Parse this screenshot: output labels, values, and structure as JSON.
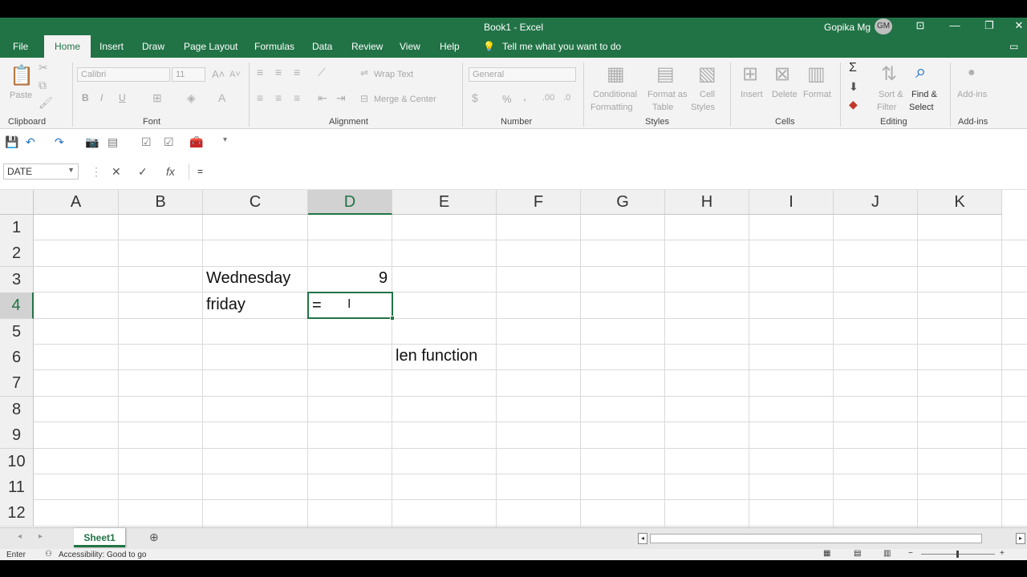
{
  "titlebar": {
    "title": "Book1  -  Excel",
    "user": "Gopika Mg",
    "initials": "GM"
  },
  "menu": {
    "file": "File",
    "home": "Home",
    "insert": "Insert",
    "draw": "Draw",
    "page_layout": "Page Layout",
    "formulas": "Formulas",
    "data": "Data",
    "review": "Review",
    "view": "View",
    "help": "Help",
    "tell_me": "Tell me what you want to do"
  },
  "ribbon": {
    "clipboard": {
      "label": "Clipboard",
      "paste": "Paste"
    },
    "font": {
      "label": "Font",
      "font_name": "Calibri",
      "font_size": "11",
      "bold": "B",
      "italic": "I",
      "underline": "U"
    },
    "alignment": {
      "label": "Alignment",
      "wrap_text": "Wrap Text",
      "merge_center": "Merge & Center"
    },
    "number": {
      "label": "Number",
      "format": "General",
      "percent": "%",
      "comma": ","
    },
    "styles": {
      "label": "Styles",
      "conditional": "Conditional",
      "formatting": "Formatting",
      "format_as": "Format as",
      "table": "Table",
      "cell": "Cell",
      "cell_styles": "Styles"
    },
    "cells": {
      "label": "Cells",
      "insert": "Insert",
      "delete": "Delete",
      "format": "Format"
    },
    "editing": {
      "label": "Editing",
      "sort": "Sort &",
      "filter": "Filter",
      "find": "Find &",
      "select": "Select"
    },
    "addins": {
      "label": "Add-ins",
      "addins": "Add-ins"
    }
  },
  "formula_bar": {
    "name_box": "DATE",
    "content": "="
  },
  "columns": [
    "A",
    "B",
    "C",
    "D",
    "E",
    "F",
    "G",
    "H",
    "I",
    "J",
    "K"
  ],
  "rows": [
    "1",
    "2",
    "3",
    "4",
    "5",
    "6",
    "7",
    "8",
    "9",
    "10",
    "11",
    "12"
  ],
  "cells": {
    "C3": "Wednesday",
    "D3": "9",
    "C4": "friday",
    "D4": "=",
    "E6": "len function"
  },
  "sheets": {
    "active": "Sheet1"
  },
  "status": {
    "mode": "Enter",
    "accessibility": "Accessibility: Good to go"
  },
  "colors": {
    "accent": "#217346"
  }
}
